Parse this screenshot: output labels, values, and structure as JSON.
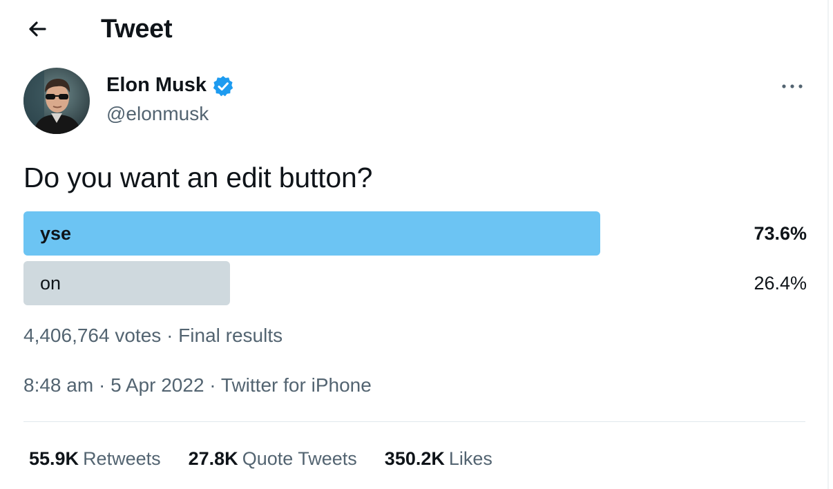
{
  "header": {
    "title": "Tweet",
    "back_icon": "arrow-left-icon"
  },
  "author": {
    "name": "Elon Musk",
    "handle": "@elonmusk",
    "verified_icon": "verified-badge-icon",
    "verified_color": "#1d9bf0"
  },
  "tweet": {
    "text": "Do you want an edit button?"
  },
  "poll": {
    "options": [
      {
        "label": "yse",
        "percent_text": "73.6%",
        "percent": 73.6,
        "color": "#6cc4f3",
        "winner": true
      },
      {
        "label": "on",
        "percent_text": "26.4%",
        "percent": 26.4,
        "color": "#cfd9de",
        "winner": false
      }
    ],
    "votes": "4,406,764 votes",
    "separator": "·",
    "status": "Final results"
  },
  "timestamp": {
    "time": "8:48 am",
    "separator": "·",
    "date": "5 Apr 2022",
    "source": "Twitter for iPhone"
  },
  "stats": {
    "retweets_count": "55.9K",
    "retweets_label": "Retweets",
    "quotes_count": "27.8K",
    "quotes_label": "Quote Tweets",
    "likes_count": "350.2K",
    "likes_label": "Likes"
  },
  "colors": {
    "text_primary": "#0f1419",
    "text_secondary": "#536471",
    "accent": "#1d9bf0"
  }
}
